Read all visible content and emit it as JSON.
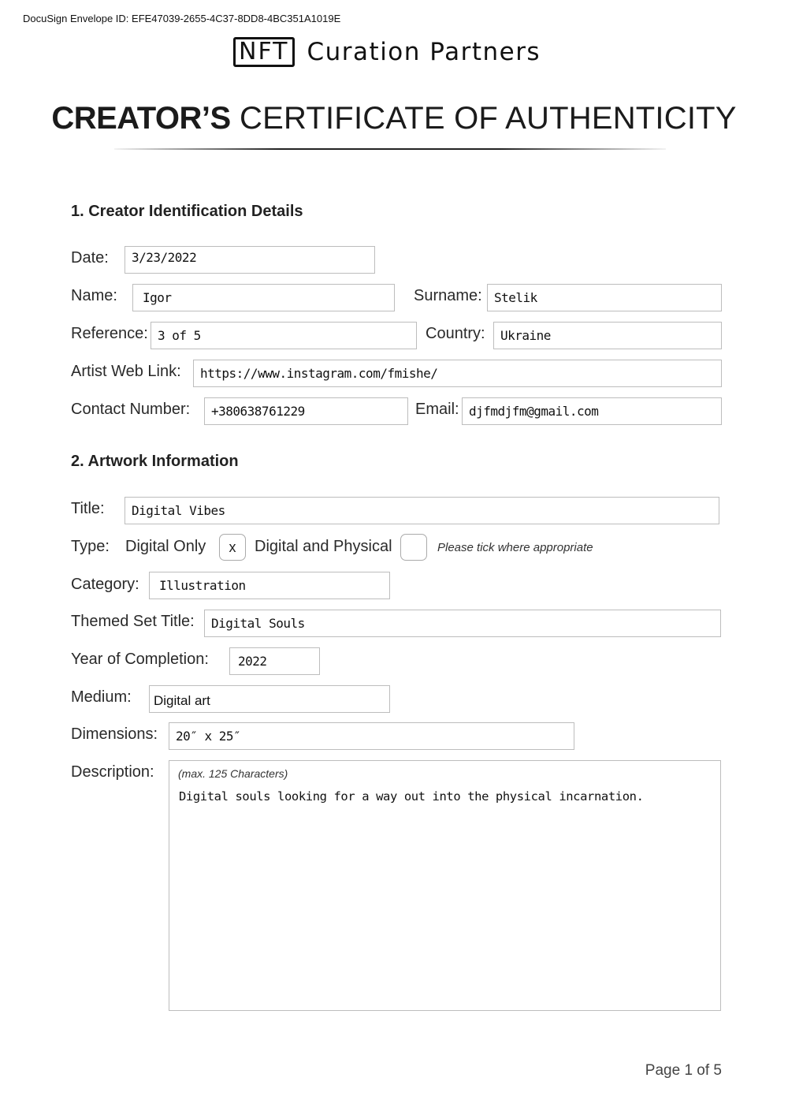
{
  "envelope_id_line": "DocuSign Envelope ID: EFE47039-2655-4C37-8DD8-4BC351A1019E",
  "brand": {
    "boxed": "NFT",
    "name": "Curation Partners"
  },
  "title": {
    "bold_part": "CREATOR’S",
    "light_part": "CERTIFICATE OF AUTHENTICITY"
  },
  "section1": {
    "heading": "1. Creator Identification Details",
    "date": {
      "label": "Date:",
      "value": "3/23/2022"
    },
    "name": {
      "label": "Name:",
      "value": "Igor"
    },
    "surname": {
      "label": "Surname:",
      "value": "Stelik"
    },
    "reference": {
      "label": "Reference:",
      "value": "3 of 5"
    },
    "country": {
      "label": "Country:",
      "value": "Ukraine"
    },
    "web_link": {
      "label": "Artist Web Link:",
      "value": "https://www.instagram.com/fmishe/"
    },
    "contact": {
      "label": "Contact Number:",
      "value": "+380638761229"
    },
    "email": {
      "label": "Email:",
      "value": "djfmdjfm@gmail.com"
    }
  },
  "section2": {
    "heading": "2. Artwork Information",
    "title": {
      "label": "Title:",
      "value": "Digital Vibes"
    },
    "type": {
      "label": "Type:",
      "options": [
        {
          "label": "Digital Only",
          "mark": "x",
          "checked": true
        },
        {
          "label": "Digital and Physical",
          "mark": "",
          "checked": false
        }
      ],
      "hint": "Please tick where appropriate"
    },
    "category": {
      "label": "Category:",
      "value": "Illustration"
    },
    "themed_set": {
      "label": "Themed Set Title:",
      "value": "Digital Souls"
    },
    "year": {
      "label": "Year of Completion:",
      "value": "2022"
    },
    "medium": {
      "label": "Medium:",
      "value": "Digital art"
    },
    "dimensions": {
      "label": "Dimensions:",
      "value": "20″ x 25″"
    },
    "description": {
      "label": "Description:",
      "hint": "(max. 125 Characters)",
      "value": "Digital souls looking for a way out into the physical incarnation."
    }
  },
  "footer": {
    "page": "Page 1 of 5"
  }
}
